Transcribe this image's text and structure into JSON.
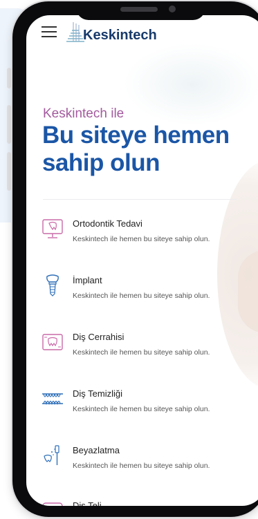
{
  "header": {
    "menu_icon": "hamburger-menu-icon",
    "logo_text": "Keskintech",
    "logo_icon": "keskintech-logo-mark"
  },
  "hero": {
    "subtitle": "Keskintech ile",
    "title": "Bu siteye hemen sahip olun"
  },
  "services": [
    {
      "title": "Ortodontik Tedavi",
      "description": "Keskintech ile hemen bu siteye sahip olun.",
      "icon": "monitor-tooth-icon"
    },
    {
      "title": "İmplant",
      "description": "Keskintech ile hemen bu siteye sahip olun.",
      "icon": "implant-icon"
    },
    {
      "title": "Diş Cerrahisi",
      "description": "Keskintech ile hemen bu siteye sahip olun.",
      "icon": "tooth-scan-icon"
    },
    {
      "title": "Diş Temizliği",
      "description": "Keskintech ile hemen bu siteye sahip olun.",
      "icon": "teeth-cleaning-icon"
    },
    {
      "title": "Beyazlatma",
      "description": "Keskintech ile hemen bu siteye sahip olun.",
      "icon": "whitening-brush-icon"
    },
    {
      "title": "Diş Teli",
      "description": "",
      "icon": "braces-icon"
    }
  ],
  "colors": {
    "brand_blue": "#1b56a6",
    "accent_purple": "#a35a9e",
    "logo_navy": "#173a6b",
    "icon_pink": "#c96aa8",
    "icon_blue": "#2f6fb8"
  }
}
